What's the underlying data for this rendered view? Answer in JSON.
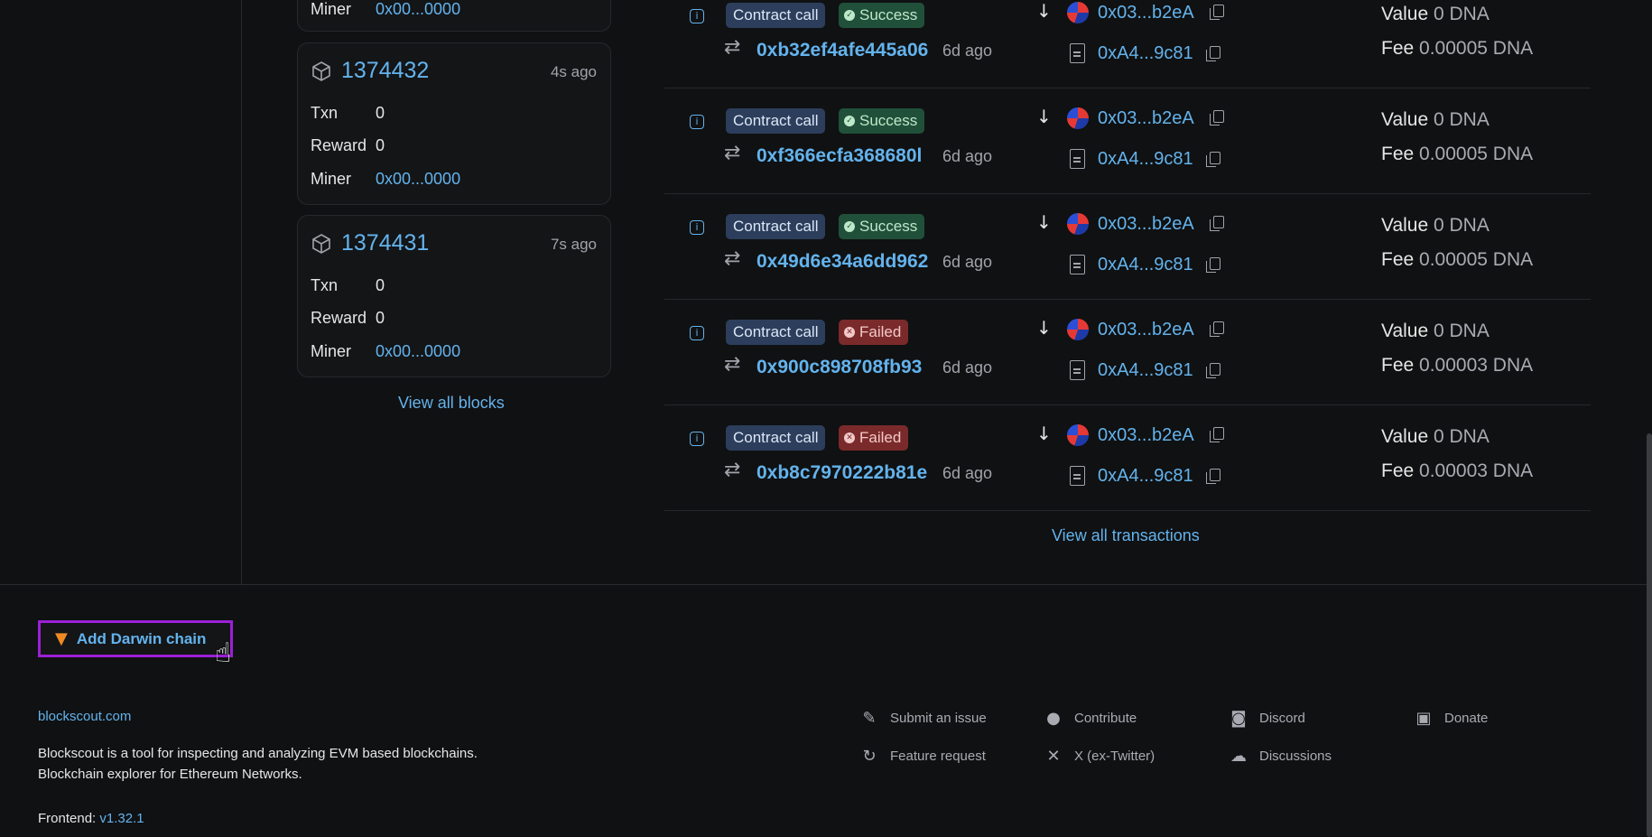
{
  "blocks": {
    "labels": {
      "txn": "Txn",
      "reward": "Reward",
      "miner": "Miner"
    },
    "top_partial": {
      "miner_label": "Miner",
      "miner_value": "0x00...0000"
    },
    "items": [
      {
        "number": "1374432",
        "age": "4s ago",
        "txn": "0",
        "reward": "0",
        "miner": "0x00...0000"
      },
      {
        "number": "1374431",
        "age": "7s ago",
        "txn": "0",
        "reward": "0",
        "miner": "0x00...0000"
      }
    ],
    "view_all": "View all blocks"
  },
  "transactions": {
    "items": [
      {
        "type": "Contract call",
        "status": "Success",
        "hash": "0xb32ef4afe445a06",
        "age": "6d ago",
        "from": "0x03...b2eA",
        "to": "0xA4...9c81",
        "value_label": "Value",
        "value": "0 DNA",
        "fee_label": "Fee",
        "fee": "0.00005 DNA"
      },
      {
        "type": "Contract call",
        "status": "Success",
        "hash": "0xf366ecfa368680l",
        "age": "6d ago",
        "from": "0x03...b2eA",
        "to": "0xA4...9c81",
        "value_label": "Value",
        "value": "0 DNA",
        "fee_label": "Fee",
        "fee": "0.00005 DNA"
      },
      {
        "type": "Contract call",
        "status": "Success",
        "hash": "0x49d6e34a6dd962",
        "age": "6d ago",
        "from": "0x03...b2eA",
        "to": "0xA4...9c81",
        "value_label": "Value",
        "value": "0 DNA",
        "fee_label": "Fee",
        "fee": "0.00005 DNA"
      },
      {
        "type": "Contract call",
        "status": "Failed",
        "hash": "0x900c898708fb93",
        "age": "6d ago",
        "from": "0x03...b2eA",
        "to": "0xA4...9c81",
        "value_label": "Value",
        "value": "0 DNA",
        "fee_label": "Fee",
        "fee": "0.00003 DNA"
      },
      {
        "type": "Contract call",
        "status": "Failed",
        "hash": "0xb8c7970222b81e",
        "age": "6d ago",
        "from": "0x03...b2eA",
        "to": "0xA4...9c81",
        "value_label": "Value",
        "value": "0 DNA",
        "fee_label": "Fee",
        "fee": "0.00003 DNA"
      }
    ],
    "view_all": "View all transactions"
  },
  "footer": {
    "add_chain": "Add Darwin chain",
    "site_link": "blockscout.com",
    "desc_line1": "Blockscout is a tool for inspecting and analyzing EVM based blockchains.",
    "desc_line2": "Blockchain explorer for Ethereum Networks.",
    "frontend_label": "Frontend: ",
    "frontend_version": "v1.32.1",
    "links": {
      "submit_issue": "Submit an issue",
      "contribute": "Contribute",
      "discord": "Discord",
      "donate": "Donate",
      "feature_request": "Feature request",
      "twitter": "X (ex-Twitter)",
      "discussions": "Discussions"
    }
  },
  "colors": {
    "accent": "#63b3ed",
    "background": "#101112",
    "success": "#21503a",
    "failed": "#7a2a2a",
    "highlight": "#9b20d6"
  }
}
